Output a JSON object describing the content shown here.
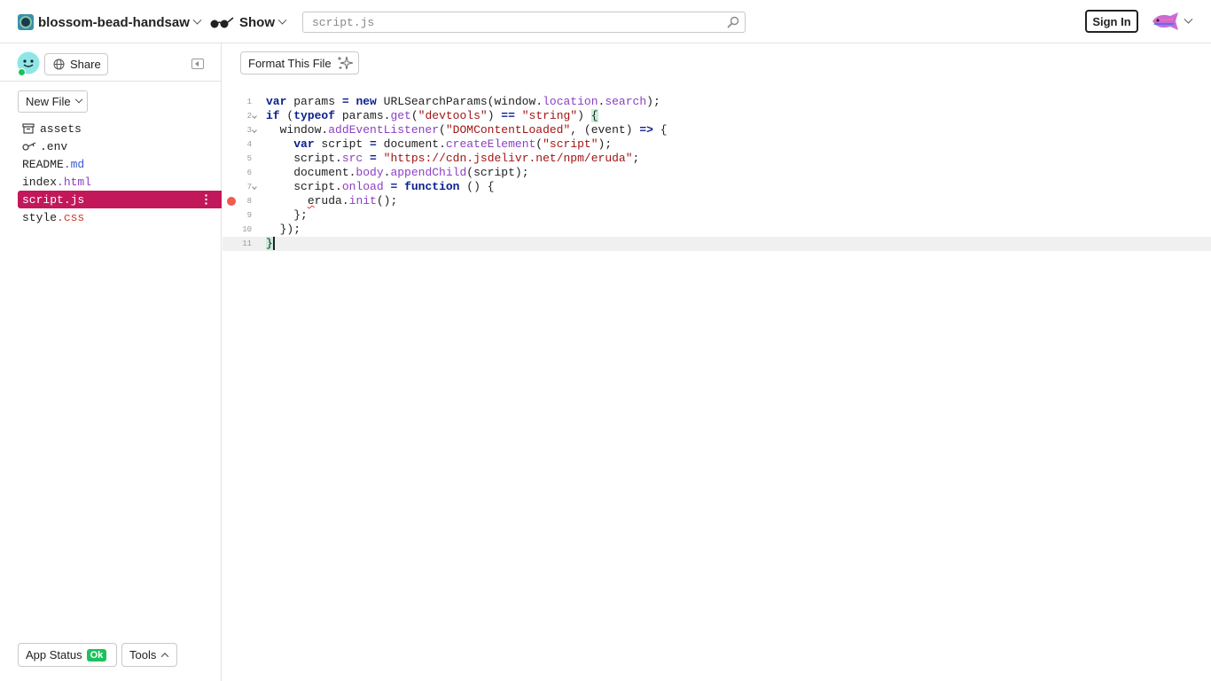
{
  "header": {
    "project_name": "blossom-bead-handsaw",
    "show_label": "Show",
    "search_placeholder": "script.js",
    "signin_label": "Sign In"
  },
  "sidebar": {
    "share_label": "Share",
    "new_file_label": "New File",
    "files": [
      {
        "name": "assets",
        "ext": "",
        "icon": "archive-icon"
      },
      {
        "name": ".env",
        "ext": "",
        "icon": "key-icon"
      },
      {
        "name": "README",
        "ext": ".md"
      },
      {
        "name": "index",
        "ext": ".html"
      },
      {
        "name": "script",
        "ext": ".js",
        "selected": true
      },
      {
        "name": "style",
        "ext": ".css"
      }
    ],
    "app_status_label": "App Status",
    "app_status_badge": "Ok",
    "tools_label": "Tools"
  },
  "editor": {
    "format_label": "Format This File",
    "line_numbers": [
      "1",
      "2",
      "3",
      "4",
      "5",
      "6",
      "7",
      "8",
      "9",
      "10",
      "11"
    ],
    "strings": {
      "devtools": "\"devtools\"",
      "string": "\"string\"",
      "dom_loaded": "\"DOMContentLoaded\"",
      "script": "\"script\"",
      "cdn": "\"https://cdn.jsdelivr.net/npm/eruda\""
    },
    "breakpoint_line": "8",
    "active_line": "11"
  },
  "colors": {
    "accent": "#c2185b",
    "ok": "#1cc15b",
    "breakpoint": "#f05a4f"
  }
}
